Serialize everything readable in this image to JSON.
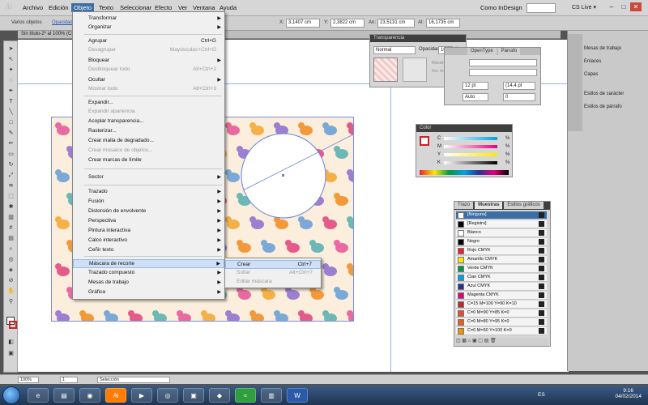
{
  "app": {
    "logo": "Ai",
    "workspace": "Como InDesign",
    "cs_live": "CS Live ▾"
  },
  "menubar": {
    "items": [
      "Archivo",
      "Edición",
      "Objeto",
      "Texto",
      "Seleccionar",
      "Efecto",
      "Ver",
      "Ventana",
      "Ayuda"
    ]
  },
  "controlbar": {
    "selection_label": "Varios objetos",
    "opacity_label": "Opacidad",
    "x_label": "X:",
    "x": "3,1407 cm",
    "y_label": "Y:",
    "y": "2,3822 cm",
    "w_label": "An:",
    "w": "23,5131 cm",
    "h_label": "Al:",
    "h": "16,1735 cm"
  },
  "doctab": {
    "title": "Sin título-2* al 100% (CMYK/Previsualizar)"
  },
  "object_menu": {
    "items": [
      {
        "label": "Transformar",
        "shortcut": "",
        "arrow": "▶",
        "disabled": false
      },
      {
        "label": "Organizar",
        "shortcut": "",
        "arrow": "▶",
        "disabled": false
      },
      {
        "label": "Agrupar",
        "shortcut": "Ctrl+G",
        "arrow": "",
        "disabled": false
      },
      {
        "label": "Desagrupar",
        "shortcut": "Mayúsculas+Ctrl+G",
        "arrow": "",
        "disabled": true
      },
      {
        "label": "Bloquear",
        "shortcut": "",
        "arrow": "▶",
        "disabled": false
      },
      {
        "label": "Desbloquear todo",
        "shortcut": "Alt+Ctrl+2",
        "arrow": "",
        "disabled": true
      },
      {
        "label": "Ocultar",
        "shortcut": "",
        "arrow": "▶",
        "disabled": false
      },
      {
        "label": "Mostrar todo",
        "shortcut": "Alt+Ctrl+3",
        "arrow": "",
        "disabled": true
      },
      {
        "label": "Expandir...",
        "shortcut": "",
        "arrow": "",
        "disabled": false
      },
      {
        "label": "Expandir apariencia",
        "shortcut": "",
        "arrow": "",
        "disabled": true
      },
      {
        "label": "Acoplar transparencia...",
        "shortcut": "",
        "arrow": "",
        "disabled": false
      },
      {
        "label": "Rasterizar...",
        "shortcut": "",
        "arrow": "",
        "disabled": false
      },
      {
        "label": "Crear malla de degradado...",
        "shortcut": "",
        "arrow": "",
        "disabled": false
      },
      {
        "label": "Crear mosaico de objetos...",
        "shortcut": "",
        "arrow": "",
        "disabled": true
      },
      {
        "label": "Crear marcas de límite",
        "shortcut": "",
        "arrow": "",
        "disabled": false
      },
      {
        "label": "Sector",
        "shortcut": "",
        "arrow": "▶",
        "disabled": false
      },
      {
        "label": "Trazado",
        "shortcut": "",
        "arrow": "▶",
        "disabled": false
      },
      {
        "label": "Fusión",
        "shortcut": "",
        "arrow": "▶",
        "disabled": false
      },
      {
        "label": "Distorsión de envolvente",
        "shortcut": "",
        "arrow": "▶",
        "disabled": false
      },
      {
        "label": "Perspectiva",
        "shortcut": "",
        "arrow": "▶",
        "disabled": false
      },
      {
        "label": "Pintura interactiva",
        "shortcut": "",
        "arrow": "▶",
        "disabled": false
      },
      {
        "label": "Calco interactivo",
        "shortcut": "",
        "arrow": "▶",
        "disabled": false
      },
      {
        "label": "Ceñir texto",
        "shortcut": "",
        "arrow": "▶",
        "disabled": false
      },
      {
        "label": "Máscara de recorte",
        "shortcut": "",
        "arrow": "▶",
        "disabled": false
      },
      {
        "label": "Trazado compuesto",
        "shortcut": "",
        "arrow": "▶",
        "disabled": false
      },
      {
        "label": "Mesas de trabajo",
        "shortcut": "",
        "arrow": "▶",
        "disabled": false
      },
      {
        "label": "Gráfica",
        "shortcut": "",
        "arrow": "▶",
        "disabled": false
      }
    ]
  },
  "clipping_submenu": {
    "items": [
      {
        "label": "Crear",
        "shortcut": "Ctrl+7",
        "disabled": false
      },
      {
        "label": "Soltar",
        "shortcut": "Alt+Ctrl+7",
        "disabled": true
      },
      {
        "label": "Editar máscara",
        "shortcut": "",
        "disabled": true
      }
    ]
  },
  "transparency_panel": {
    "title": "Transparencia",
    "mode": "Normal",
    "opacity_label": "Opacidad:",
    "opacity": "100",
    "opacity_unit": "%",
    "recortar": "Recortar",
    "invert_mask": "Inv. máscara"
  },
  "character_panel": {
    "tabs": [
      "OpenType",
      "Párrafo"
    ],
    "size": "12 pt",
    "leading": "(14,4 pt",
    "tracking": "Auto",
    "kerning": "0"
  },
  "color_panel": {
    "title": "Color",
    "channels": [
      "C",
      "M",
      "Y",
      "K"
    ],
    "unit": "%"
  },
  "swatches_panel": {
    "tabs": [
      "Trazo",
      "Muestras",
      "Estilos gráficos"
    ],
    "items": [
      {
        "name": "[Ninguno]",
        "color": "#ffffff"
      },
      {
        "name": "[Registro]",
        "color": "#000000"
      },
      {
        "name": "Blanco",
        "color": "#ffffff"
      },
      {
        "name": "Negro",
        "color": "#000000"
      },
      {
        "name": "Rojo CMYK",
        "color": "#e3262f"
      },
      {
        "name": "Amarillo CMYK",
        "color": "#ffe600"
      },
      {
        "name": "Verde CMYK",
        "color": "#009a44"
      },
      {
        "name": "Cian CMYK",
        "color": "#00a3e0"
      },
      {
        "name": "Azul CMYK",
        "color": "#28338f"
      },
      {
        "name": "Magenta CMYK",
        "color": "#e5007e"
      },
      {
        "name": "C=15 M=100 Y=90 K=10",
        "color": "#c1272d"
      },
      {
        "name": "C=0 M=90 Y=85 K=0",
        "color": "#e84a2c"
      },
      {
        "name": "C=0 M=80 Y=95 K=0",
        "color": "#ea5b1e"
      },
      {
        "name": "C=0 M=50 Y=100 K=0",
        "color": "#f39200"
      }
    ]
  },
  "right_dock": {
    "items": [
      "Mesas de trabajo",
      "Enlaces",
      "Capas",
      "Estilos de carácter",
      "Estilos de párrafo"
    ]
  },
  "status": {
    "zoom": "100%",
    "page": "1",
    "mode": "Selección"
  },
  "taskbar": {
    "lang": "ES",
    "time": "9:16",
    "date": "04/02/2014"
  }
}
